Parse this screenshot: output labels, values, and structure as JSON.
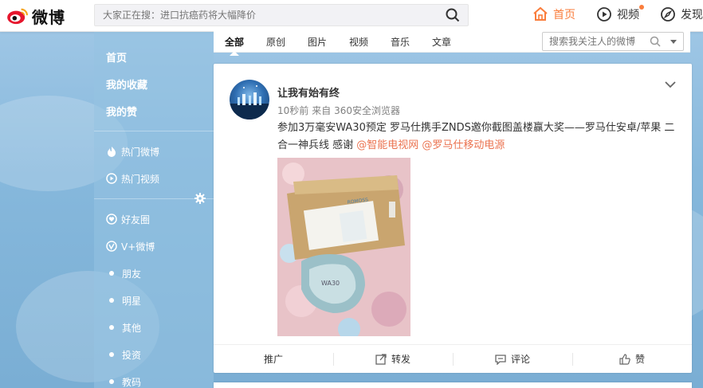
{
  "brand": {
    "name": "微博"
  },
  "search": {
    "placeholder": "大家正在搜：进口抗癌药将大幅降价"
  },
  "topnav": {
    "home": "首页",
    "video": "视频",
    "discover": "发现"
  },
  "sidebar": {
    "main": [
      "首页",
      "我的收藏",
      "我的赞"
    ],
    "hot": [
      "热门微博",
      "热门视频"
    ],
    "groups": [
      "好友圈",
      "V+微博",
      "朋友",
      "明星",
      "其他",
      "投资",
      "教码"
    ]
  },
  "tabs": [
    "全部",
    "原创",
    "图片",
    "视频",
    "音乐",
    "文章"
  ],
  "follow_search": {
    "placeholder": "搜索我关注人的微博"
  },
  "post": {
    "username": "让我有始有终",
    "time": "10秒前",
    "source": "来自 360安全浏览器",
    "text": "参加3万毫安WA30预定 罗马仕携手ZNDS邀你截图盖楼赢大奖——罗马仕安卓/苹果 二合一神兵线 感谢 ",
    "mention1": "@智能电视网",
    "mention2": "@罗马仕移动电源",
    "image_box_text": "WA30"
  },
  "actions": {
    "promote": "推广",
    "repost": "转发",
    "comment": "评论",
    "like": "赞"
  },
  "colors": {
    "accent": "#fa7d3c",
    "mention": "#eb7350"
  }
}
